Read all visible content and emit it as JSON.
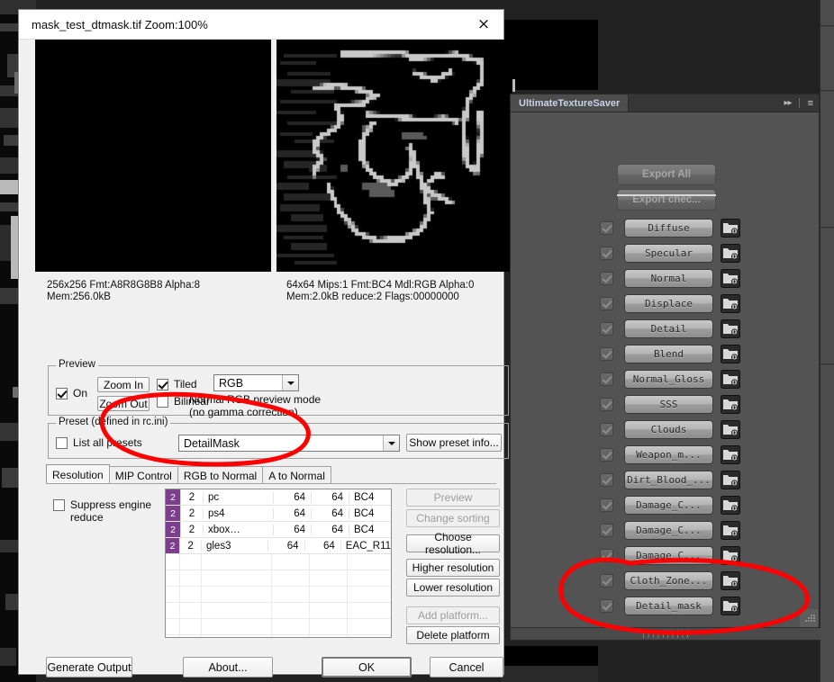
{
  "dialog": {
    "title": "mask_test_dtmask.tif  Zoom:100%",
    "close_icon": "×",
    "preview_left_info": "256x256 Fmt:A8R8G8B8 Alpha:8\nMem:256.0kB",
    "preview_right_info": "64x64 Mips:1 Fmt:BC4 Mdl:RGB Alpha:0\nMem:2.0kB reduce:2 Flags:00000000",
    "preview_group": {
      "legend": "Preview",
      "on_label": "On",
      "on_checked": true,
      "zoom_in": "Zoom In",
      "zoom_out": "Zoom Out",
      "tiled_label": "Tiled",
      "tiled_checked": true,
      "bilinear_label": "Bilinear",
      "bilinear_checked": false,
      "mode_value": "RGB",
      "mode_note_line1": "Normal RGB preview mode",
      "mode_note_line2": "(no gamma correction)"
    },
    "preset_group": {
      "legend": "Preset (defined in rc.ini)",
      "list_all_label": "List all presets",
      "list_all_checked": false,
      "preset_value": "DetailMask",
      "show_info_button": "Show preset info..."
    },
    "tabs": [
      {
        "label": "Resolution",
        "active": true
      },
      {
        "label": "MIP Control",
        "active": false
      },
      {
        "label": "RGB to Normal",
        "active": false
      },
      {
        "label": "A to Normal",
        "active": false
      }
    ],
    "suppress_label_line1": "Suppress engine",
    "suppress_label_line2": "reduce",
    "suppress_checked": false,
    "resolution_table": {
      "rows": [
        {
          "sel": "2",
          "num": "2",
          "platform": "pc",
          "width": "64",
          "height": "64",
          "format": "BC4"
        },
        {
          "sel": "2",
          "num": "2",
          "platform": "ps4",
          "width": "64",
          "height": "64",
          "format": "BC4"
        },
        {
          "sel": "2",
          "num": "2",
          "platform": "xbox…",
          "width": "64",
          "height": "64",
          "format": "BC4"
        },
        {
          "sel": "2",
          "num": "2",
          "platform": "gles3",
          "width": "64",
          "height": "64",
          "format": "EAC_R11"
        }
      ]
    },
    "side_buttons": [
      {
        "label": "Preview",
        "disabled": true
      },
      {
        "label": "Change sorting",
        "disabled": true
      },
      {
        "label": "Choose resolution...",
        "disabled": false
      },
      {
        "label": "Higher resolution",
        "disabled": false
      },
      {
        "label": "Lower resolution",
        "disabled": false
      },
      {
        "label": "Add platform...",
        "disabled": true
      },
      {
        "label": "Delete platform",
        "disabled": false
      }
    ],
    "bottom_buttons": [
      {
        "label": "Generate Output",
        "default": false
      },
      {
        "label": "About...",
        "default": false
      },
      {
        "label": "OK",
        "default": true
      },
      {
        "label": "Cancel",
        "default": false
      }
    ]
  },
  "uts_panel": {
    "tab_label": "UltimateTextureSaver",
    "collapse_icon": "▸▸",
    "menu_icon": "≡",
    "export_all": "Export All",
    "export_checked": "Export chec...",
    "rows": [
      {
        "label": "Diffuse",
        "checked": true
      },
      {
        "label": "Specular",
        "checked": true
      },
      {
        "label": "Normal",
        "checked": true
      },
      {
        "label": "Displace",
        "checked": true
      },
      {
        "label": "Detail",
        "checked": true
      },
      {
        "label": "Blend",
        "checked": true
      },
      {
        "label": "Normal_Gloss",
        "checked": true
      },
      {
        "label": "SSS",
        "checked": true
      },
      {
        "label": "Clouds",
        "checked": true
      },
      {
        "label": "Weapon_m...",
        "checked": true
      },
      {
        "label": "Dirt_Blood_...",
        "checked": true
      },
      {
        "label": "Damage_C...",
        "checked": true
      },
      {
        "label": "Damage_C...",
        "checked": true
      },
      {
        "label": "Damage_C...",
        "checked": true
      },
      {
        "label": "Cloth_Zone...",
        "checked": true
      },
      {
        "label": "Detail_mask",
        "checked": true
      }
    ],
    "folder_icon": "folder-add-icon"
  },
  "annotations": {
    "color": "#fe0000",
    "ellipse_preset": "hand-drawn ellipse around preset combo box",
    "ellipse_detail_mask": "hand-drawn ellipse around Detail_mask row"
  },
  "colors": {
    "accent_purple": "#7b3f8c",
    "annotation_red": "#fe0000",
    "panel_bg": "#535353",
    "dialog_bg": "#f0f0f0"
  }
}
